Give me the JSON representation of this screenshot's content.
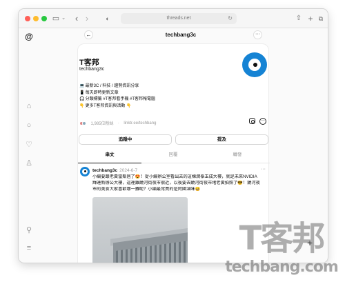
{
  "browser": {
    "url": "threads.net",
    "icons": [
      "sidebar-icon",
      "chevron-down-icon",
      "back-icon",
      "forward-icon",
      "shield-icon",
      "refresh-icon",
      "share-icon",
      "new-tab-icon",
      "tabs-overview-icon"
    ]
  },
  "rail": {
    "logo": "threads-logo-icon",
    "items": [
      "home-icon",
      "search-icon",
      "heart-icon",
      "profile-icon",
      "pin-icon",
      "menu-icon"
    ]
  },
  "header": {
    "title": "techbang3c",
    "back_glyph": "←",
    "more_glyph": "···"
  },
  "profile": {
    "name": "T客邦",
    "handle": "techbang3c",
    "bio": [
      {
        "icon": "💻",
        "text": "最新3C / 科技 / 趨勢資訊分享"
      },
      {
        "icon": "📱",
        "text": "每天即時更新文章"
      },
      {
        "icon": "🎧",
        "text": "分類標籤 #T客邦看手機 #T客邦報電腦"
      },
      {
        "icon": "👇",
        "text": "更多T客邦資訊與活動 👇"
      }
    ],
    "followers": "1,985位粉絲",
    "link": "linktr.ee/techbang",
    "separator": "·",
    "colors": {
      "brand": "#1583d4"
    }
  },
  "actions": {
    "following_label": "追蹤中",
    "mention_label": "提及"
  },
  "tabs": [
    {
      "label": "串文",
      "active": true
    },
    {
      "label": "回覆",
      "active": false
    },
    {
      "label": "轉發",
      "active": false
    }
  ],
  "post": {
    "author": "techbang3c",
    "date": "2024-6-7",
    "more_glyph": "···",
    "lines": [
      "小編要跟老黃當鄰居了😍！從小編辦公室看出去的這棟潤泰玉成大樓，就是未來NVIDIA",
      "輝達新辦公大樓，這裡離饒河街夜市很近，以後要去饒河街夜市堵老黃拍照了😎！饒河夜",
      "市的美食大家喜歡哪一攤呢？小編最常買的是阿國滷味😄"
    ]
  },
  "fab": {
    "glyph": "+"
  },
  "watermark": {
    "brand": "T客邦",
    "domain": "techbang.com"
  }
}
